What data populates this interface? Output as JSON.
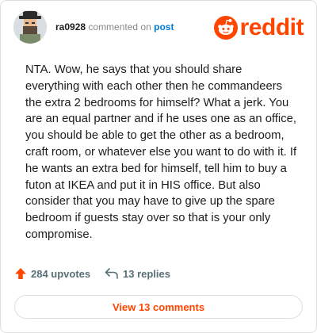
{
  "header": {
    "username": "ra0928",
    "commented_on": "commented on",
    "post_link": "post",
    "brand": "reddit",
    "brand_color": "#ff4500"
  },
  "comment": {
    "body": "NTA. Wow, he says that you should share everything with each other then he commandeers the extra 2 bedrooms for himself? What a jerk. You are an equal partner and if he uses one as an office, you should be able to get the other as a bedroom, craft room, or whatever else you want to do with it. If he wants an extra bed for himself, tell him to buy a futon at IKEA and put it in HIS office. But also consider that you may have to give up the spare bedroom if guests stay over so that is your only compromise."
  },
  "actions": {
    "upvotes": "284 upvotes",
    "replies": "13 replies",
    "view_comments": "View 13 comments"
  },
  "icons": {
    "avatar": "user-avatar",
    "logo": "reddit-snoo-icon",
    "upvote": "upvote-arrow-icon",
    "reply": "reply-arrow-icon"
  }
}
